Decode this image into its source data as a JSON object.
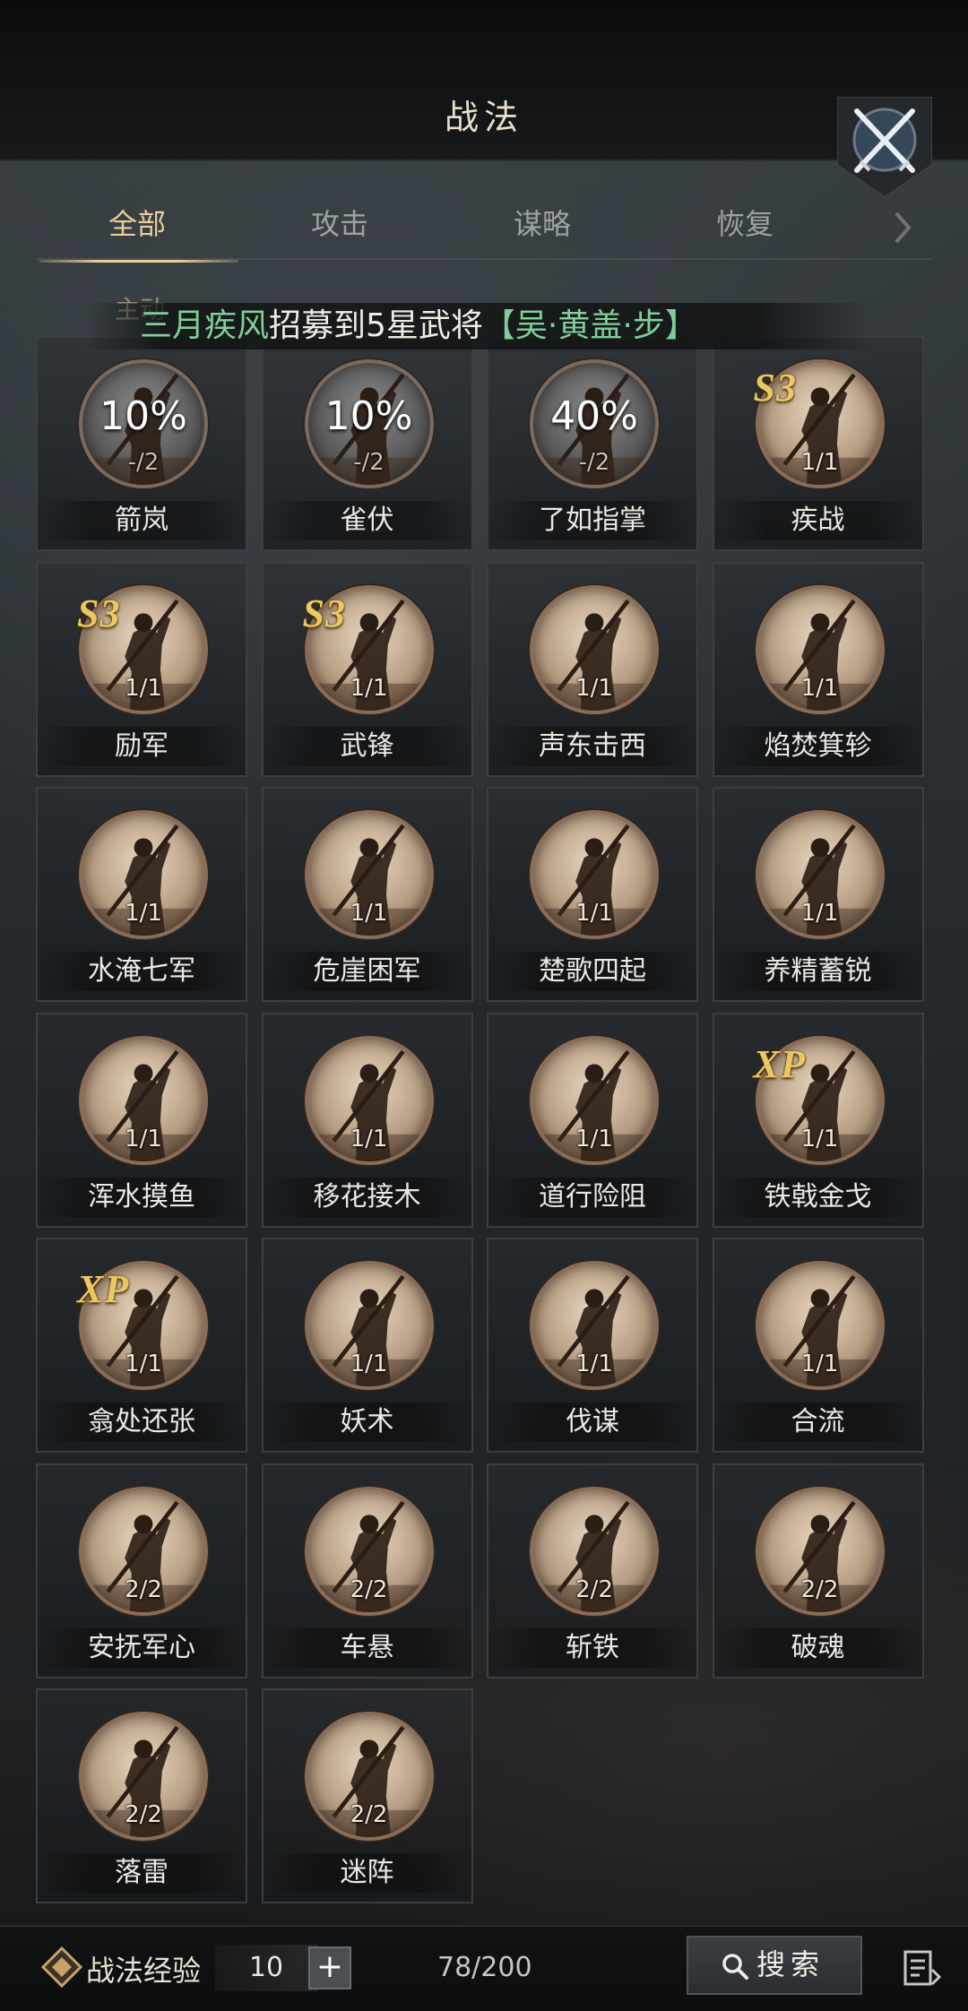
{
  "header": {
    "title": "战法"
  },
  "tabs": [
    {
      "label": "全部",
      "active": true
    },
    {
      "label": "攻击",
      "active": false
    },
    {
      "label": "谋略",
      "active": false
    },
    {
      "label": "恢复",
      "active": false
    }
  ],
  "section": {
    "label": "主动"
  },
  "marquee": {
    "player": "三月疾风",
    "text": "招募到5星武将",
    "general": "【吴·黄盖·步】"
  },
  "skills": [
    {
      "name": "箭岚",
      "count": "-/2",
      "progress": "10%",
      "badge": "",
      "locked": true
    },
    {
      "name": "雀伏",
      "count": "-/2",
      "progress": "10%",
      "badge": "",
      "locked": true
    },
    {
      "name": "了如指掌",
      "count": "-/2",
      "progress": "40%",
      "badge": "",
      "locked": true
    },
    {
      "name": "疾战",
      "count": "1/1",
      "progress": "",
      "badge": "S3",
      "locked": false
    },
    {
      "name": "励军",
      "count": "1/1",
      "progress": "",
      "badge": "S3",
      "locked": false
    },
    {
      "name": "武锋",
      "count": "1/1",
      "progress": "",
      "badge": "S3",
      "locked": false
    },
    {
      "name": "声东击西",
      "count": "1/1",
      "progress": "",
      "badge": "",
      "locked": false
    },
    {
      "name": "焰焚箕轸",
      "count": "1/1",
      "progress": "",
      "badge": "",
      "locked": false
    },
    {
      "name": "水淹七军",
      "count": "1/1",
      "progress": "",
      "badge": "",
      "locked": false
    },
    {
      "name": "危崖困军",
      "count": "1/1",
      "progress": "",
      "badge": "",
      "locked": false
    },
    {
      "name": "楚歌四起",
      "count": "1/1",
      "progress": "",
      "badge": "",
      "locked": false
    },
    {
      "name": "养精蓄锐",
      "count": "1/1",
      "progress": "",
      "badge": "",
      "locked": false
    },
    {
      "name": "浑水摸鱼",
      "count": "1/1",
      "progress": "",
      "badge": "",
      "locked": false
    },
    {
      "name": "移花接木",
      "count": "1/1",
      "progress": "",
      "badge": "",
      "locked": false
    },
    {
      "name": "道行险阻",
      "count": "1/1",
      "progress": "",
      "badge": "",
      "locked": false
    },
    {
      "name": "铁戟金戈",
      "count": "1/1",
      "progress": "",
      "badge": "XP",
      "locked": false
    },
    {
      "name": "翕处还张",
      "count": "1/1",
      "progress": "",
      "badge": "XP",
      "locked": false
    },
    {
      "name": "妖术",
      "count": "1/1",
      "progress": "",
      "badge": "",
      "locked": false
    },
    {
      "name": "伐谋",
      "count": "1/1",
      "progress": "",
      "badge": "",
      "locked": false
    },
    {
      "name": "合流",
      "count": "1/1",
      "progress": "",
      "badge": "",
      "locked": false
    },
    {
      "name": "安抚军心",
      "count": "2/2",
      "progress": "",
      "badge": "",
      "locked": false
    },
    {
      "name": "车悬",
      "count": "2/2",
      "progress": "",
      "badge": "",
      "locked": false
    },
    {
      "name": "斩铁",
      "count": "2/2",
      "progress": "",
      "badge": "",
      "locked": false
    },
    {
      "name": "破魂",
      "count": "2/2",
      "progress": "",
      "badge": "",
      "locked": false
    },
    {
      "name": "落雷",
      "count": "2/2",
      "progress": "",
      "badge": "",
      "locked": false
    },
    {
      "name": "迷阵",
      "count": "2/2",
      "progress": "",
      "badge": "",
      "locked": false
    }
  ],
  "footer": {
    "exp_label": "战法经验",
    "exp_value": "10",
    "plus_label": "+",
    "capacity": "78/200",
    "search_label": "搜索"
  },
  "colors": {
    "accent": "#e7cf97",
    "marquee_highlight": "#7fcf9a",
    "badge": "#ecc865"
  },
  "icons": [
    "crossed-swords-icon",
    "chevron-right-icon",
    "warrior-figure-icon",
    "exp-token-icon",
    "search-icon",
    "menu-list-icon"
  ]
}
